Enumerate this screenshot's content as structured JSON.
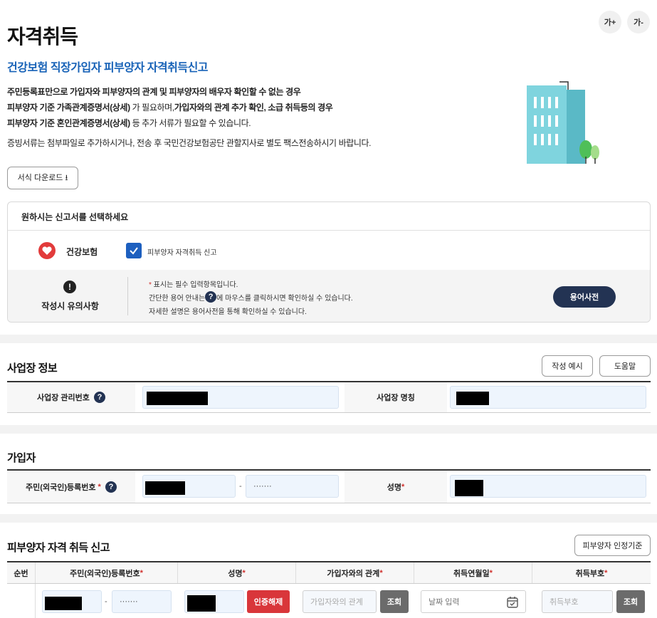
{
  "font_controls": {
    "increase": "가+",
    "decrease": "가-"
  },
  "page": {
    "title": "자격취득",
    "subtitle": "건강보험 직장가입자 피부양자 자격취득신고",
    "desc_line1_bold": "주민등록표만으로 가입자와 피부양자의 관계 및 피부양자의 배우자 확인할 수 없는 경우",
    "desc_line2_bold_a": "피부양자 기준 가족관계증명서(상세)",
    "desc_line2_mid": " 가 필요하며,",
    "desc_line2_bold_b": "가입자와의 관계 추가 확인, 소급 취득등의 경우",
    "desc_line3_bold": "피부양자 기준 혼인관계증명서(상세)",
    "desc_line3_rest": " 등 추가 서류가 필요할 수 있습니다.",
    "desc_line4": "증빙서류는 첨부파일로 추가하시거나, 전송 후 국민건강보험공단 관할지사로 별도 팩스전송하시기 바랍니다.",
    "download_button": "서식 다운로드 ⭳"
  },
  "report_select": {
    "heading": "원하시는 신고서를 선택하세요",
    "insurance_label": "건강보험",
    "checkbox_label": "피부양자 자격취득 신고",
    "checkbox_checked": true,
    "notice_title": "작성시 유의사항",
    "notice_line1_star": "*",
    "notice_line1": " 표시는 필수 입력항목입니다.",
    "notice_line2_a": "간단한 용어 안내는 ",
    "notice_line2_b": " 에 마우스를 클릭하시면 확인하실 수 있습니다.",
    "notice_line3": "자세한 설명은 용어사전을 통해 확인하실 수 있습니다.",
    "glossary_button": "용어사전"
  },
  "workplace": {
    "title": "사업장 정보",
    "example_button": "작성 예시",
    "help_button": "도움말",
    "mgmt_no_label": "사업장 관리번호",
    "name_label": "사업장 명칭"
  },
  "subscriber": {
    "title": "가입자",
    "rrn_label": "주민(외국인)등록번호",
    "rrn_back": "·······",
    "rrn_dash": "-",
    "name_label": "성명"
  },
  "dependent": {
    "title": "피부양자 자격 취득 신고",
    "criteria_button": "피부양자 인정기준",
    "columns": [
      "순번",
      "주민(외국인)등록번호",
      "성명",
      "가입자와의 관계",
      "취득연월일",
      "취득부호"
    ],
    "column_required": [
      false,
      true,
      true,
      true,
      true,
      true
    ],
    "row": {
      "rrn_back": "·······",
      "rrn_dash": "-",
      "cert_release_button": "인증해제",
      "relation_placeholder": "가입자와의 관계",
      "search_button": "조회",
      "date_placeholder": "날짜 입력",
      "code_placeholder": "취득부호",
      "code_search_button": "조회"
    }
  },
  "colors": {
    "accent_blue": "#1762b7",
    "navy": "#233353",
    "required_red": "#d0312d",
    "cert_red": "#d9363a",
    "checkbox_blue": "#1d5fbf"
  }
}
